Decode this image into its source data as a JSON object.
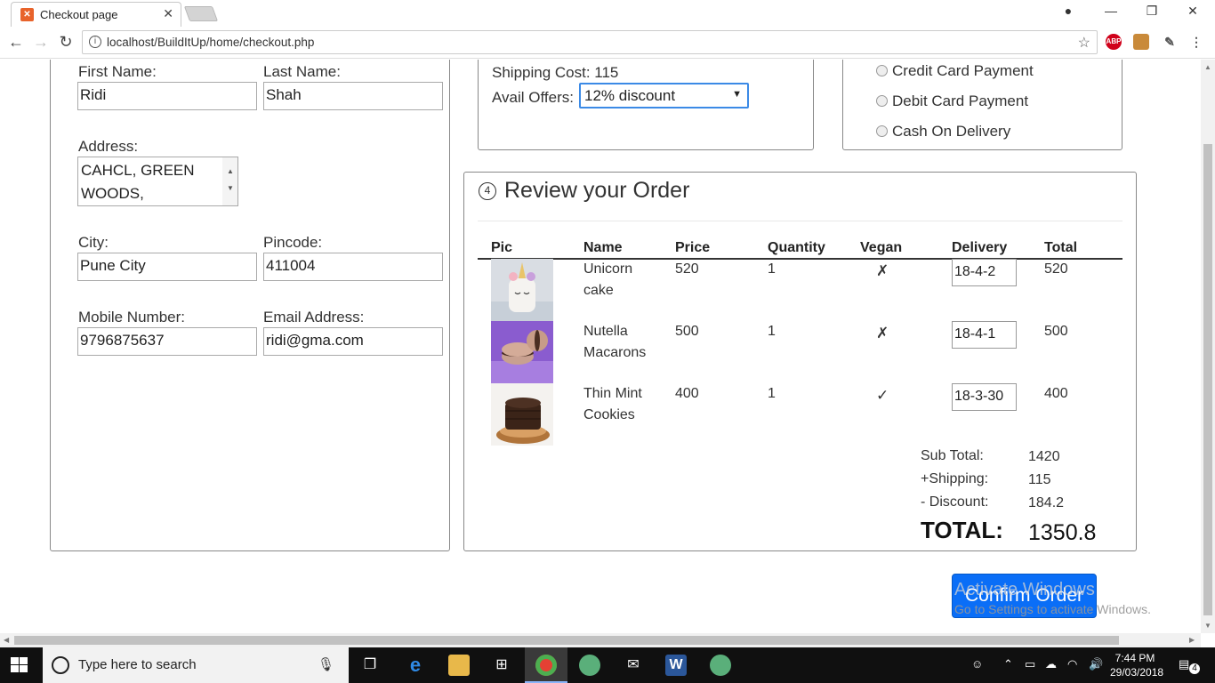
{
  "browser": {
    "tab_title": "Checkout page",
    "url": "localhost/BuildItUp/home/checkout.php",
    "ext_abp": "ABP"
  },
  "address_form": {
    "first_name_label": "First Name:",
    "first_name_value": "Ridi",
    "last_name_label": "Last Name:",
    "last_name_value": "Shah",
    "address_label": "Address:",
    "address_line1": "CAHCL, GREEN",
    "address_line2": "WOODS,",
    "city_label": "City:",
    "city_value": "Pune City",
    "pincode_label": "Pincode:",
    "pincode_value": "411004",
    "mobile_label": "Mobile Number:",
    "mobile_value": "9796875637",
    "email_label": "Email Address:",
    "email_value": "ridi@gma.com"
  },
  "shipping": {
    "cost_text": "Shipping Cost: 115",
    "offers_label": "Avail Offers:",
    "offers_selected": "12% discount"
  },
  "payment": {
    "options": [
      "Credit Card Payment",
      "Debit Card Payment",
      "Cash On Delivery"
    ]
  },
  "review": {
    "step": "4",
    "title": "Review your Order",
    "columns": [
      "Pic",
      "Name",
      "Price",
      "Quantity",
      "Vegan",
      "Delivery",
      "Total"
    ],
    "rows": [
      {
        "name_1": "Unicorn",
        "name_2": "cake",
        "price": "520",
        "qty": "1",
        "vegan": "✗",
        "delivery": "18-4-2",
        "total": "520"
      },
      {
        "name_1": "Nutella",
        "name_2": "Macarons",
        "price": "500",
        "qty": "1",
        "vegan": "✗",
        "delivery": "18-4-1",
        "total": "500"
      },
      {
        "name_1": "Thin Mint",
        "name_2": "Cookies",
        "price": "400",
        "qty": "1",
        "vegan": "✓",
        "delivery": "18-3-30",
        "total": "400"
      }
    ],
    "summary": {
      "subtotal_label": "Sub Total:",
      "subtotal_value": "1420",
      "shipping_label": "+Shipping:",
      "shipping_value": "115",
      "discount_label": "- Discount:",
      "discount_value": "184.2",
      "total_label": "TOTAL:",
      "total_value": "1350.8"
    }
  },
  "confirm_button": "Confirm Order",
  "watermark": {
    "line1": "Activate Windows",
    "line2": "Go to Settings to activate Windows."
  },
  "taskbar": {
    "search_placeholder": "Type here to search",
    "time": "7:44 PM",
    "date": "29/03/2018",
    "notifications": "4"
  }
}
